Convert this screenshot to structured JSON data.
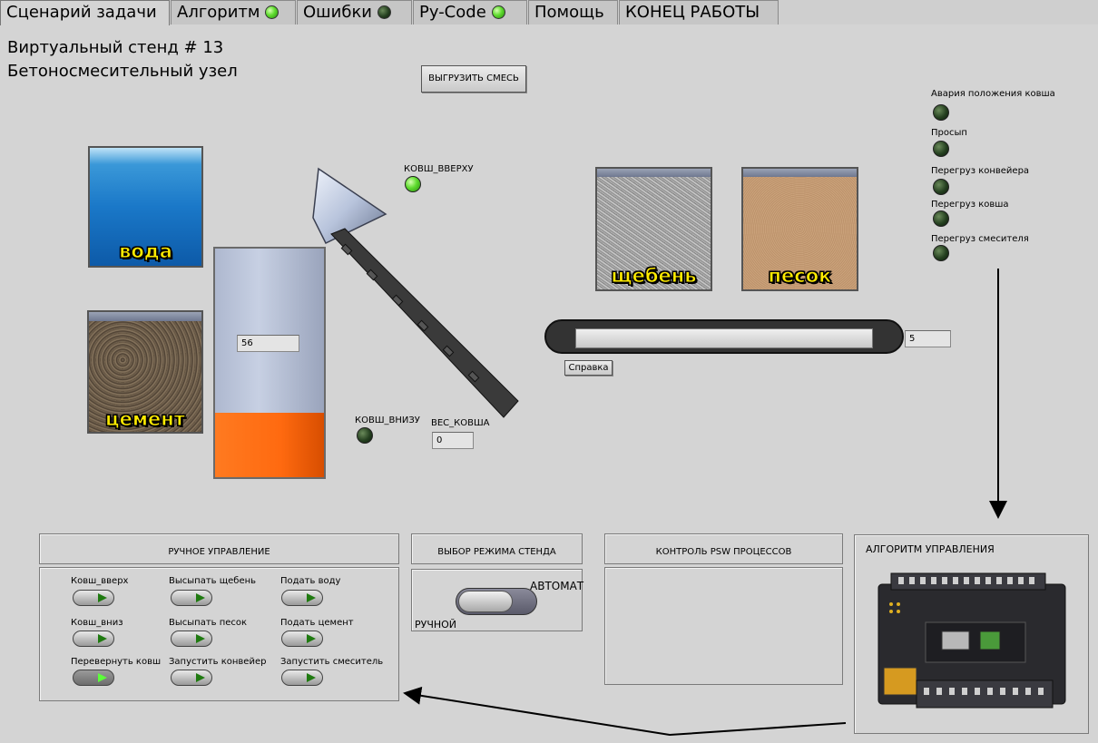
{
  "tabs": [
    {
      "label": "Сценарий задачи",
      "active": true,
      "indicator": null
    },
    {
      "label": "Алгоритм",
      "active": false,
      "indicator": "green"
    },
    {
      "label": "Ошибки",
      "active": false,
      "indicator": "dark"
    },
    {
      "label": "Py-Code",
      "active": false,
      "indicator": "green"
    },
    {
      "label": "Помощь",
      "active": false,
      "indicator": null
    },
    {
      "label": "КОНЕЦ РАБОТЫ",
      "active": false,
      "indicator": null
    }
  ],
  "header": {
    "title_line1": "Виртуальный стенд # 13",
    "title_line2": "Бетоносмесительный узел"
  },
  "unload_button": "ВЫГРУЗИТЬ СМЕСЬ",
  "bins": {
    "water": "вода",
    "cement": "цемент",
    "gravel": "щебень",
    "sand": "песок"
  },
  "mixer": {
    "value": "56",
    "fill_fraction": 0.28
  },
  "bucket": {
    "top_label": "КОВШ_ВВЕРХУ",
    "top_led": "on",
    "bottom_label": "КОВШ_ВНИЗУ",
    "bottom_led": "off",
    "weight_label": "ВЕС_КОВША",
    "weight_value": "0"
  },
  "conveyor": {
    "value": "5",
    "help_button": "Справка"
  },
  "alarms": [
    {
      "label": "Авария положения ковша",
      "state": "off"
    },
    {
      "label": "Просып",
      "state": "off"
    },
    {
      "label": "Перегруз конвейера",
      "state": "off"
    },
    {
      "label": "Перегруз ковша",
      "state": "off"
    },
    {
      "label": "Перегруз смесителя",
      "state": "off"
    }
  ],
  "manual": {
    "title": "РУЧНОЕ УПРАВЛЕНИЕ",
    "controls": [
      {
        "label": "Ковш_вверх",
        "on": false
      },
      {
        "label": "Высыпать щебень",
        "on": false
      },
      {
        "label": "Подать воду",
        "on": false
      },
      {
        "label": "Ковш_вниз",
        "on": false
      },
      {
        "label": "Высыпать песок",
        "on": false
      },
      {
        "label": "Подать цемент",
        "on": false
      },
      {
        "label": "Перевернуть ковш",
        "on": true
      },
      {
        "label": "Запустить конвейер",
        "on": false
      },
      {
        "label": "Запустить смеситель",
        "on": false
      }
    ]
  },
  "mode": {
    "title": "ВЫБОР РЕЖИМА СТЕНДА",
    "auto_label": "АВТОМАТ",
    "manual_label": "РУЧНОЙ"
  },
  "psw": {
    "title": "КОНТРОЛЬ PSW ПРОЦЕССОВ"
  },
  "algorithm": {
    "title": "АЛГОРИТМ УПРАВЛЕНИЯ"
  },
  "colors": {
    "led_on": "#5fdc2f",
    "led_off": "#254020",
    "mixer_fill": "#ff6a10",
    "mixer_body": "#b8c2d8",
    "water": "#1a78c8"
  }
}
